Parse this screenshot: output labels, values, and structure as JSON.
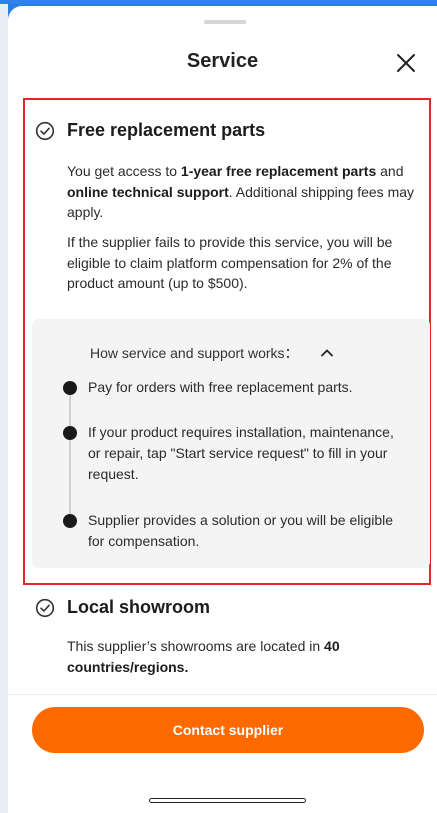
{
  "header": {
    "title": "Service"
  },
  "replacement": {
    "title": "Free replacement parts",
    "para1": {
      "t1": "You get access to ",
      "b1": "1-year free replacement parts",
      "t2": " and ",
      "b2": "online technical support",
      "t3": ". Additional shipping fees may apply."
    },
    "para2": "If the supplier fails to provide this service, you will be eligible to claim platform compensation for 2% of the product amount (up to $500).",
    "how": {
      "heading": "How service and support works：",
      "steps": [
        "Pay for orders with free replacement parts.",
        "If your product requires installation, maintenance, or repair, tap \"Start service request\" to fill in your request.",
        "Supplier provides a solution or you will be eligible for compensation."
      ]
    }
  },
  "showroom": {
    "title": "Local showroom",
    "text": "This supplier’s showrooms are located in ",
    "bold": "40 countries/regions."
  },
  "cta": {
    "label": "Contact supplier"
  },
  "colors": {
    "accent": "#ff6a00",
    "highlight_border": "#e02828"
  },
  "icons": [
    "check-circle-icon",
    "close-icon",
    "chevron-up-icon"
  ]
}
